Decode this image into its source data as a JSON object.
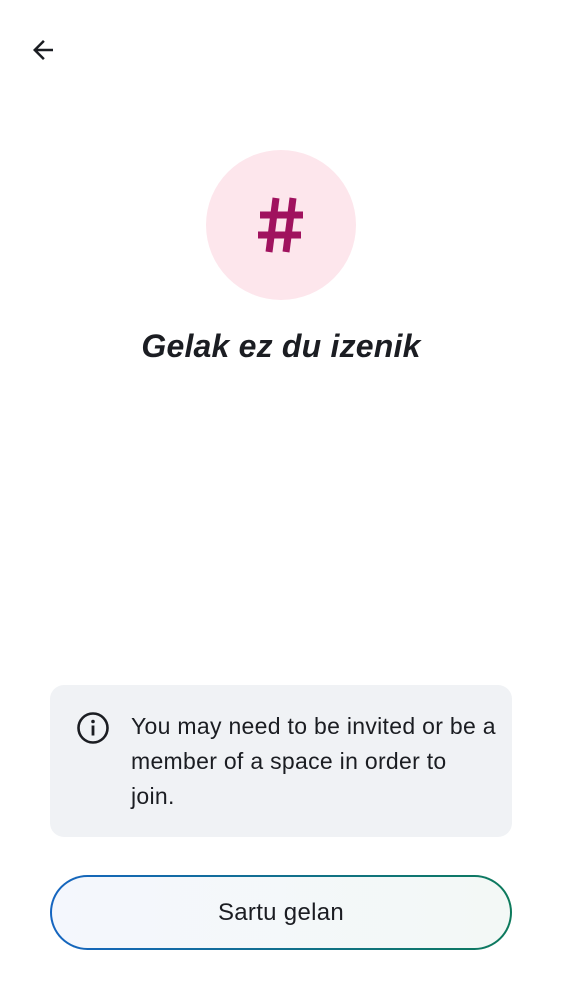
{
  "header": {
    "back_icon": "arrow-left-icon"
  },
  "room": {
    "avatar_symbol": "#",
    "avatar_icon": "hash-icon",
    "title": "Gelak ez du izenik",
    "avatar_bg": "#fde6ec",
    "avatar_fg": "#a0125e"
  },
  "notice": {
    "icon": "info-icon",
    "text": "You may need to be invited or be a member of a space in order to join."
  },
  "actions": {
    "join_label": "Sartu gelan"
  },
  "colors": {
    "text": "#1b1d22",
    "card_bg": "#f0f2f5",
    "button_border_start": "#1565c0",
    "button_border_end": "#0d7a5c"
  }
}
